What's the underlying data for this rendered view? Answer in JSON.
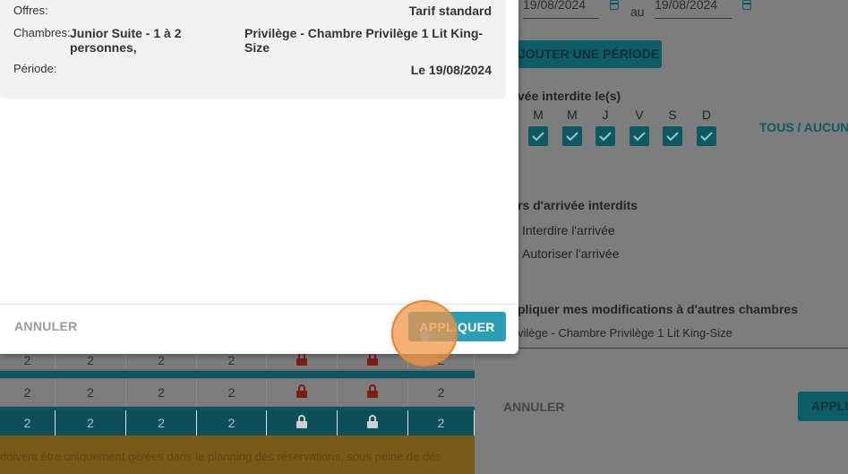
{
  "background_grid": {
    "row_a": [
      "2",
      "2",
      "2",
      "2",
      "lock",
      "lock",
      "2"
    ],
    "row_b": [
      "2",
      "2",
      "2",
      "2",
      "lock",
      "lock",
      "2"
    ],
    "row_c": [
      "2",
      "2",
      "2",
      "2",
      "lock",
      "lock",
      "2"
    ],
    "warning_text": "doivent être uniquement gérées dans le planning des réservations, sous peine de dés"
  },
  "right_panel": {
    "date_from": "19/08/2024",
    "date_sep": "au",
    "date_to": "19/08/2024",
    "add_period_label": "JOUTER UNE PÉRIODE",
    "forbidden_arrival_title": "vée interdite le(s)",
    "days": [
      "M",
      "M",
      "J",
      "V",
      "S",
      "D"
    ],
    "all_none_label": "TOUS / AUCUN",
    "forbidden_days_title": "rs d'arrivée interdits",
    "radio_forbid": "Interdire l'arrivée",
    "radio_allow": "Autoriser l'arrivée",
    "apply_other_rooms_title": "pliquer mes modifications à d'autres chambres",
    "room_select_value": "vilège - Chambre Privilège 1 Lit King-Size",
    "cancel_label": "ANNULER",
    "apply_label": "APPLI"
  },
  "modal": {
    "offers_label": "Offres:",
    "offers_value": "Tarif standard",
    "rooms_label": "Chambres:",
    "room_1": "Junior Suite - 1 à 2 personnes,",
    "room_2": "Privilège - Chambre Privilège 1 Lit King-Size",
    "period_label": "Période:",
    "period_value": "Le 19/08/2024",
    "cancel_label": "ANNULER",
    "apply_label": "APPLIQUER"
  },
  "colors": {
    "accent": "#2a9fb3",
    "click_indicator": "#f39646"
  }
}
